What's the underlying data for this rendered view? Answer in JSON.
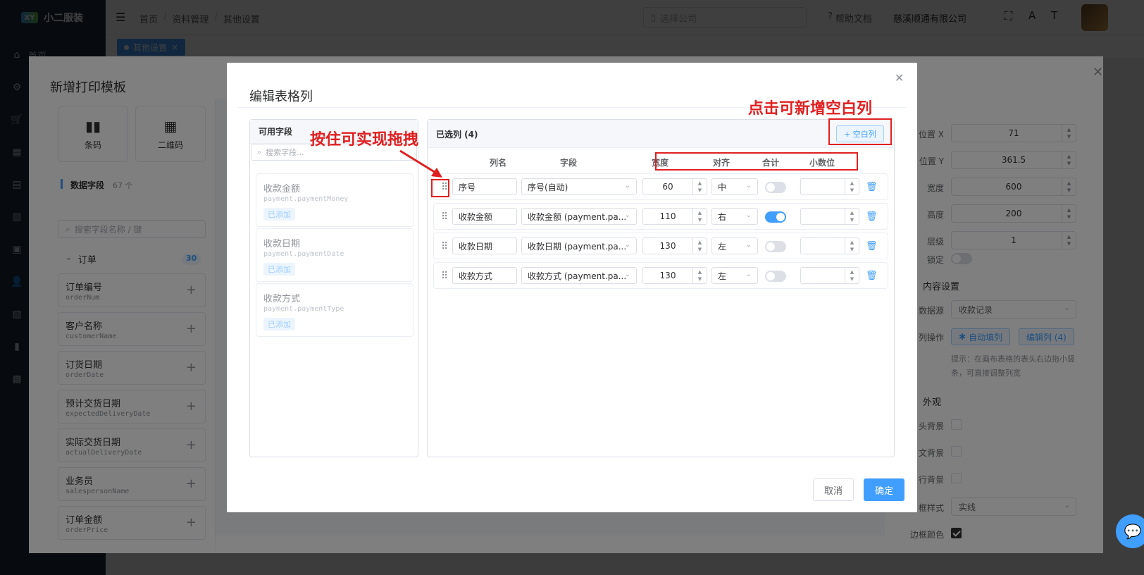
{
  "app": {
    "name": "小二服装",
    "logo_text": "XY"
  },
  "sidebar": {
    "items": [
      {
        "icon": "home-icon",
        "glyph": "⌂",
        "label": "首页"
      },
      {
        "icon": "gear-icon",
        "glyph": "⚙",
        "label": ""
      },
      {
        "icon": "cart-icon",
        "glyph": "🛒",
        "label": ""
      },
      {
        "icon": "grid-icon",
        "glyph": "▦",
        "label": ""
      },
      {
        "icon": "document-icon",
        "glyph": "▤",
        "label": ""
      },
      {
        "icon": "book-icon",
        "glyph": "▥",
        "label": ""
      },
      {
        "icon": "chart-icon",
        "glyph": "▣",
        "label": ""
      },
      {
        "icon": "user-icon",
        "glyph": "👤",
        "label": ""
      },
      {
        "icon": "file-icon",
        "glyph": "▧",
        "label": ""
      },
      {
        "icon": "bar-chart-icon",
        "glyph": "▮",
        "label": ""
      },
      {
        "icon": "briefcase-icon",
        "glyph": "▩",
        "label": ""
      }
    ]
  },
  "topbar": {
    "breadcrumb": [
      "首页",
      "/",
      "资料管理",
      "/",
      "其他设置"
    ],
    "company_placeholder": "选择公司",
    "help": "帮助文档",
    "company_name": "慈溪顺通有限公司"
  },
  "tags": [
    {
      "label": "其他设置"
    }
  ],
  "template_dialog": {
    "title": "新增打印模板",
    "tools": [
      {
        "label": "条码",
        "icon": "bar-chart-icon",
        "glyph": "▮▮"
      },
      {
        "label": "二维码",
        "icon": "qrcode-icon",
        "glyph": "▦"
      }
    ],
    "data_fields_label": "数据字段",
    "data_fields_count": "67 个",
    "search_placeholder": "搜索字段名称 / 键",
    "group": {
      "label": "订单",
      "count": "30"
    },
    "fields": [
      {
        "name": "订单编号",
        "key": "orderNum"
      },
      {
        "name": "客户名称",
        "key": "customerName"
      },
      {
        "name": "订货日期",
        "key": "orderDate"
      },
      {
        "name": "预计交货日期",
        "key": "expectedDeliveryDate"
      },
      {
        "name": "实际交货日期",
        "key": "actualDeliveryDate"
      },
      {
        "name": "业务员",
        "key": "salespersonName"
      },
      {
        "name": "订单金额",
        "key": "orderPrice"
      }
    ],
    "props": {
      "pos_x_label": "位置 X",
      "pos_x": "71",
      "pos_y_label": "位置 Y",
      "pos_y": "361.5",
      "width_label": "宽度",
      "width": "600",
      "height_label": "高度",
      "height": "200",
      "layer_label": "层级",
      "layer": "1",
      "lock_label": "锁定",
      "content_section": "内容设置",
      "datasource_label": "数据源",
      "datasource": "收款记录",
      "column_ops_label": "列操作",
      "auto_fill": "自动填列",
      "edit_cols": "编辑列 (4)",
      "hint": "提示：在画布表格的表头右边拖小竖条，可直接调整列宽",
      "appearance_section": "外观",
      "head_bg_label": "头背景",
      "body_bg_label": "文背景",
      "row_bg_label": "行背景",
      "border_style_label": "框样式",
      "border_style": "实线",
      "border_color_label": "边框颜色"
    }
  },
  "edit_dialog": {
    "title": "编辑表格列",
    "available_title": "可用字段",
    "available_search": "搜索字段...",
    "available": [
      {
        "name": "收款金额",
        "key": "payment.paymentMoney",
        "badge": "已添加"
      },
      {
        "name": "收款日期",
        "key": "payment.paymentDate",
        "badge": "已添加"
      },
      {
        "name": "收款方式",
        "key": "payment.paymentType",
        "badge": "已添加"
      }
    ],
    "selected_title": "已选列 (4)",
    "add_blank": "+ 空白列",
    "headers": {
      "name": "列名",
      "field": "字段",
      "width": "宽度",
      "align": "对齐",
      "sum": "合计",
      "decimals": "小数位"
    },
    "rows": [
      {
        "name": "序号",
        "field": "序号(自动)",
        "width": "60",
        "align": "中",
        "sum": false,
        "decimals": ""
      },
      {
        "name": "收款金额",
        "field": "收款金额 (payment.pa...",
        "width": "110",
        "align": "右",
        "sum": true,
        "decimals": ""
      },
      {
        "name": "收款日期",
        "field": "收款日期 (payment.pa...",
        "width": "130",
        "align": "左",
        "sum": false,
        "decimals": ""
      },
      {
        "name": "收款方式",
        "field": "收款方式 (payment.pa...",
        "width": "130",
        "align": "左",
        "sum": false,
        "decimals": ""
      }
    ],
    "cancel": "取消",
    "ok": "确定"
  },
  "annotations": {
    "add_blank_note": "点击可新增空白列",
    "drag_note": "按住可实现拖拽"
  },
  "colors": {
    "primary": "#409eff",
    "annotation": "#e02020",
    "sidebar": "#1f2d3d"
  }
}
